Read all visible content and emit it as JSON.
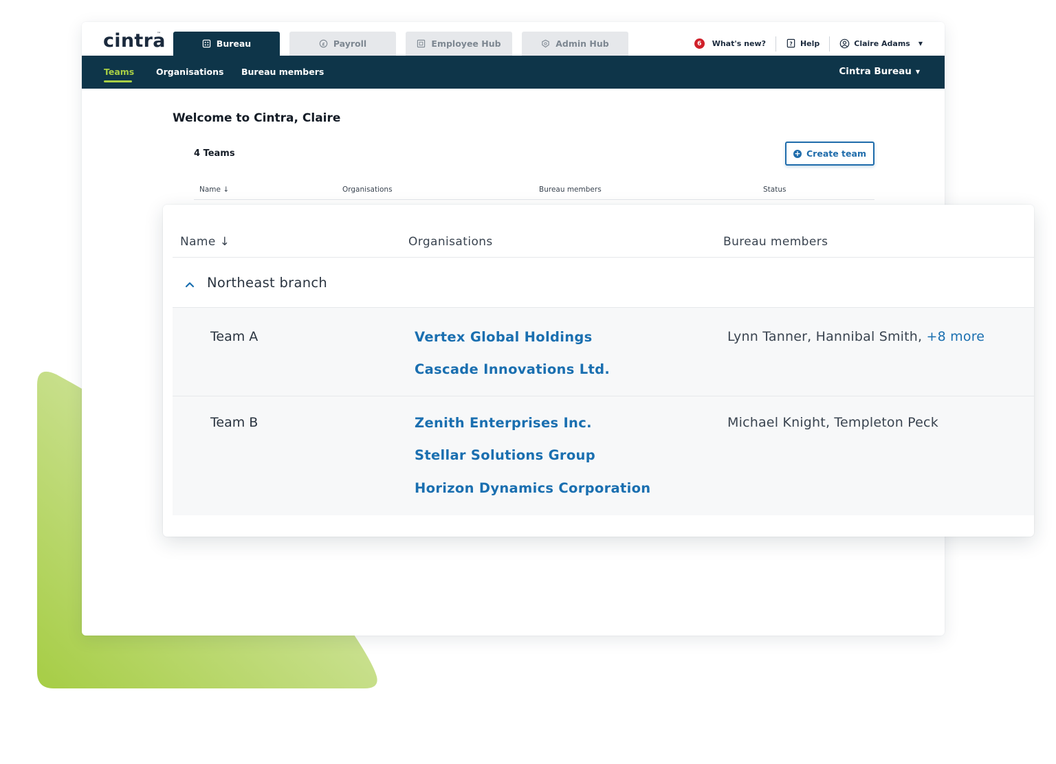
{
  "brand": {
    "logo_text": "cintra",
    "logo_tm": "™",
    "accent": "#a8cf45",
    "navy": "#0e3549",
    "link": "#1a6fb0"
  },
  "tabs": [
    {
      "label": "Bureau",
      "icon": "building-icon",
      "active": true
    },
    {
      "label": "Payroll",
      "icon": "pound-coin-icon",
      "active": false
    },
    {
      "label": "Employee Hub",
      "icon": "id-card-icon",
      "active": false
    },
    {
      "label": "Admin Hub",
      "icon": "shield-gear-icon",
      "active": false
    }
  ],
  "top_right": {
    "whats_new_count": "6",
    "whats_new_label": "What's new?",
    "help_label": "Help",
    "user_name": "Claire Adams"
  },
  "subnav": {
    "items": [
      "Teams",
      "Organisations",
      "Bureau members"
    ],
    "active": "Teams",
    "org_switch": "Cintra Bureau"
  },
  "main": {
    "welcome": "Welcome to Cintra, Claire",
    "team_count": "4 Teams",
    "create_button": "Create team",
    "columns": [
      "Name",
      "Organisations",
      "Bureau members",
      "Status"
    ],
    "sort_arrow": "↓"
  },
  "card": {
    "columns": [
      "Name",
      "Organisations",
      "Bureau members"
    ],
    "sort_arrow": "↓",
    "group": "Northeast branch",
    "teams": [
      {
        "name": "Team A",
        "organisations": [
          "Vertex Global Holdings",
          "Cascade Innovations Ltd."
        ],
        "members": "Lynn Tanner, Hannibal Smith,",
        "more": "+8 more"
      },
      {
        "name": "Team B",
        "organisations": [
          "Zenith Enterprises Inc.",
          "Stellar Solutions Group",
          "Horizon Dynamics Corporation"
        ],
        "members": "Michael Knight, Templeton Peck",
        "more": ""
      }
    ]
  }
}
